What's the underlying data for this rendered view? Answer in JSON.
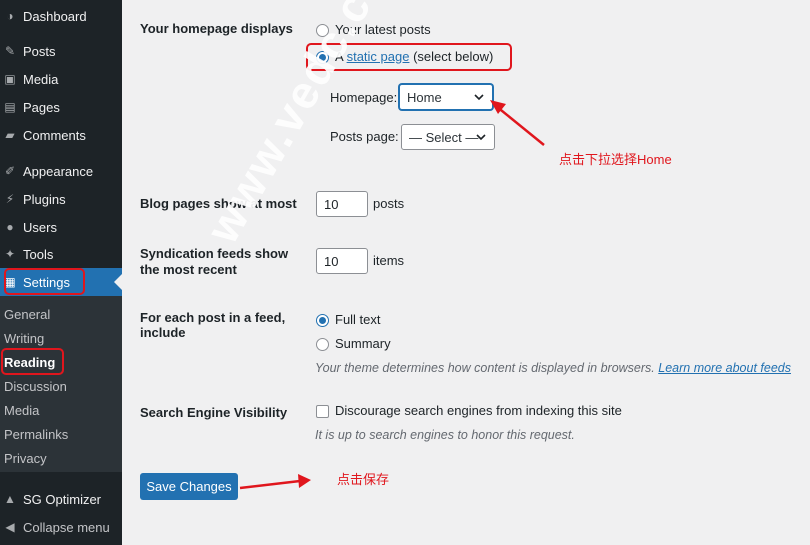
{
  "sidebar": {
    "items": [
      {
        "icon": "dashboard-icon",
        "glyph": "◑",
        "label": "Dashboard"
      },
      {
        "icon": "pushpin-icon",
        "glyph": "✎",
        "label": "Posts"
      },
      {
        "icon": "media-icon",
        "glyph": "▣",
        "label": "Media"
      },
      {
        "icon": "pages-icon",
        "glyph": "▤",
        "label": "Pages"
      },
      {
        "icon": "comments-icon",
        "glyph": "▰",
        "label": "Comments"
      },
      {
        "icon": "appearance-icon",
        "glyph": "✐",
        "label": "Appearance"
      },
      {
        "icon": "plugins-icon",
        "glyph": "⚡",
        "label": "Plugins"
      },
      {
        "icon": "users-icon",
        "glyph": "●",
        "label": "Users"
      },
      {
        "icon": "tools-icon",
        "glyph": "✦",
        "label": "Tools"
      },
      {
        "icon": "settings-icon",
        "glyph": "▦",
        "label": "Settings"
      }
    ],
    "submenu": [
      "General",
      "Writing",
      "Reading",
      "Discussion",
      "Media",
      "Permalinks",
      "Privacy"
    ],
    "sg_optimizer": {
      "icon": "sg-optimizer-icon",
      "glyph": "▲",
      "label": "SG Optimizer"
    },
    "collapse": {
      "icon": "collapse-icon",
      "glyph": "◀",
      "label": "Collapse menu"
    }
  },
  "reading": {
    "homepage_displays": {
      "label": "Your homepage displays",
      "option_latest": "Your latest posts",
      "option_static_prefix": "A",
      "option_static_link": "static page",
      "option_static_suffix": "(select below)",
      "homepage_label": "Homepage:",
      "homepage_value": "Home",
      "posts_page_label": "Posts page:",
      "posts_page_value": "— Select —"
    },
    "blog_pages": {
      "label": "Blog pages show at most",
      "value": "10",
      "unit": "posts"
    },
    "syndication": {
      "label_line1": "Syndication feeds show",
      "label_line2": "the most recent",
      "value": "10",
      "unit": "items"
    },
    "feed_include": {
      "label_line1": "For each post in a feed,",
      "label_line2": "include",
      "option_full": "Full text",
      "option_summary": "Summary",
      "desc_prefix": "Your theme determines how content is displayed in browsers.",
      "desc_link": "Learn more about feeds"
    },
    "visibility": {
      "label": "Search Engine Visibility",
      "checkbox_label": "Discourage search engines from indexing this site",
      "desc": "It is up to search engines to honor this request."
    },
    "save_label": "Save Changes"
  },
  "annotations": {
    "select_home": "点击下拉选择Home",
    "click_save": "点击保存",
    "watermark": "www.vedc.com",
    "color": "#e0161d"
  },
  "colors": {
    "accent": "#2271b1",
    "sidebar": "#1d2327",
    "submenu": "#2c3338"
  }
}
